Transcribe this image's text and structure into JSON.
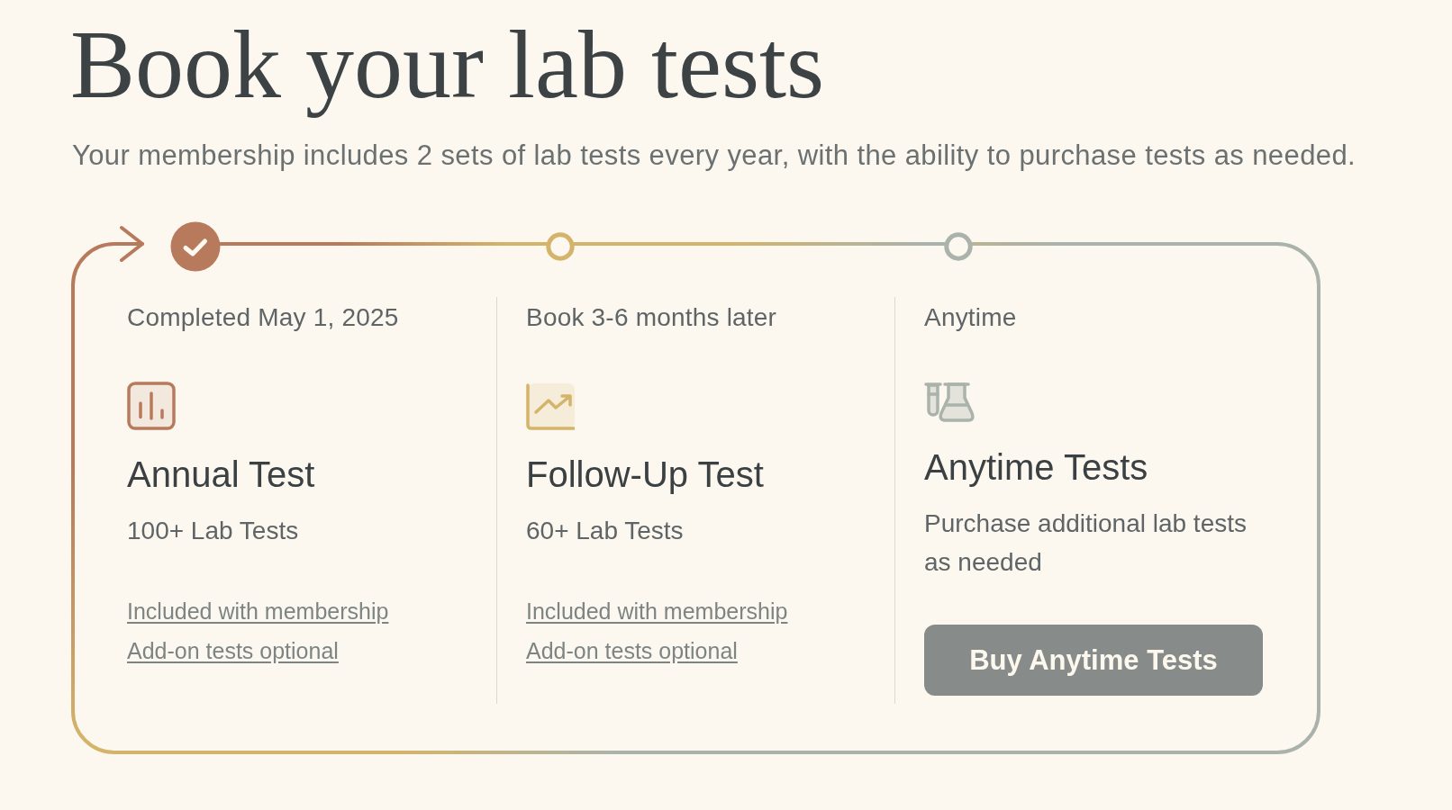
{
  "page": {
    "title": "Book your lab tests",
    "subtitle": "Your membership includes 2 sets of lab tests every year, with the ability to purchase tests as needed."
  },
  "plans": [
    {
      "timing": "Completed May 1, 2025",
      "completed": true,
      "color": "#b87a5c",
      "title": "Annual Test",
      "description": "100+ Lab Tests",
      "links": [
        "Included with membership",
        "Add-on tests optional"
      ]
    },
    {
      "timing": "Book 3-6 months later",
      "completed": false,
      "color": "#d4b46a",
      "title": "Follow-Up Test",
      "description": "60+ Lab Tests",
      "links": [
        "Included with membership",
        "Add-on tests optional"
      ]
    },
    {
      "timing": "Anytime",
      "completed": false,
      "color": "#aab3ab",
      "title": "Anytime Tests",
      "description": "Purchase additional lab tests as needed",
      "button": "Buy Anytime Tests"
    }
  ]
}
